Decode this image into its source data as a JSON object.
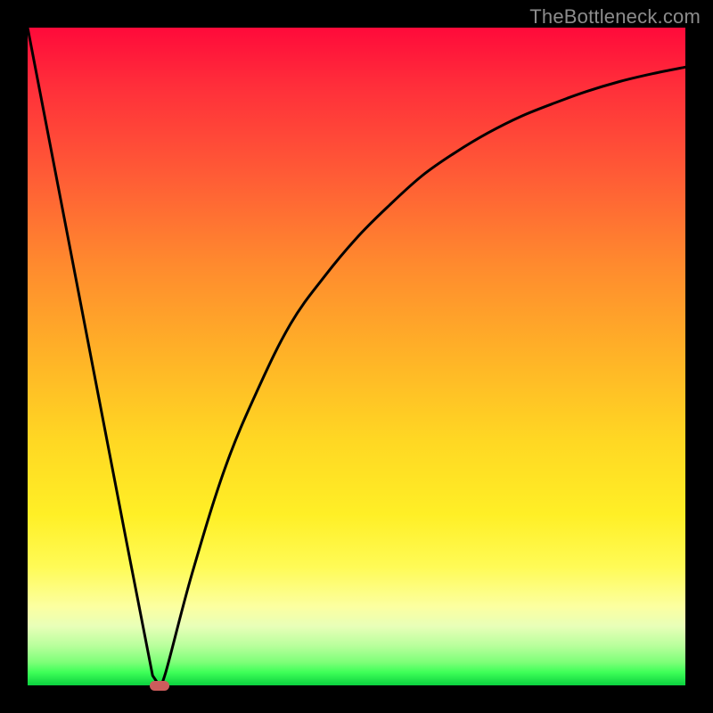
{
  "watermark": "TheBottleneck.com",
  "colors": {
    "frame": "#000000",
    "curve": "#000000",
    "marker": "#cd5c5c",
    "watermark": "#8c8c8c"
  },
  "chart_data": {
    "type": "line",
    "title": "",
    "xlabel": "",
    "ylabel": "",
    "xlim": [
      0,
      100
    ],
    "ylim": [
      0,
      100
    ],
    "grid": false,
    "series": [
      {
        "name": "bottleneck-curve",
        "x": [
          0,
          5,
          10,
          15,
          19,
          20,
          21,
          25,
          30,
          35,
          40,
          45,
          50,
          55,
          60,
          65,
          70,
          75,
          80,
          85,
          90,
          95,
          100
        ],
        "y": [
          100,
          74,
          48,
          22,
          1.5,
          0,
          2,
          17,
          33,
          45,
          55,
          62,
          68,
          73,
          77.5,
          81,
          84,
          86.5,
          88.5,
          90.3,
          91.8,
          93,
          94
        ]
      }
    ],
    "annotations": [
      {
        "name": "min-marker",
        "x_range": [
          18.5,
          21.5
        ],
        "y": 0
      }
    ],
    "notes": "V-shaped curve with steep linear left arm and saturating right arm; minimum at x≈20, y=0. Values estimated from pixels; no axis labels or ticks are rendered."
  }
}
